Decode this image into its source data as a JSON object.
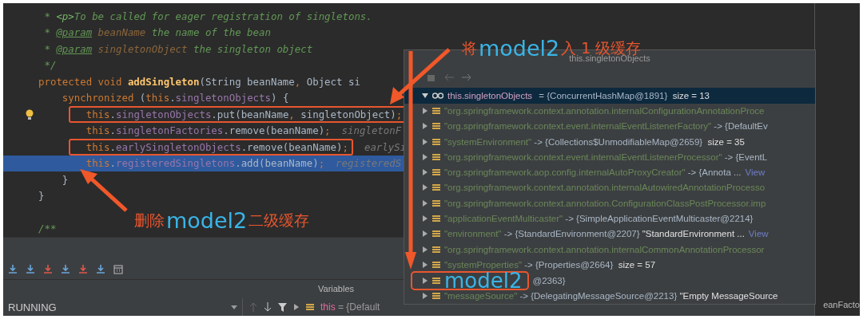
{
  "editor": {
    "lines": [
      {
        "tokens": [
          {
            "kind": "comment",
            "text": " * "
          },
          {
            "kind": "tag",
            "text": "<p>"
          },
          {
            "kind": "comment",
            "text": "To be called for eager registration of singletons."
          }
        ],
        "current": false,
        "boxed": false
      },
      {
        "tokens": [
          {
            "kind": "comment",
            "text": " * "
          },
          {
            "kind": "doctag",
            "text": "@param"
          },
          {
            "kind": "param",
            "text": " beanName"
          },
          {
            "kind": "comment",
            "text": " the name of the bean"
          }
        ],
        "current": false,
        "boxed": false
      },
      {
        "tokens": [
          {
            "kind": "comment",
            "text": " * "
          },
          {
            "kind": "doctag",
            "text": "@param"
          },
          {
            "kind": "param",
            "text": " singletonObject"
          },
          {
            "kind": "comment",
            "text": " the singleton object"
          }
        ],
        "current": false,
        "boxed": false
      },
      {
        "tokens": [
          {
            "kind": "comment",
            "text": " */"
          }
        ],
        "current": false,
        "boxed": false
      },
      {
        "tokens": [
          {
            "kind": "keyword",
            "text": "protected void "
          },
          {
            "kind": "method",
            "text": "addSingleton"
          },
          {
            "kind": "plain",
            "text": "(String beanName"
          },
          {
            "kind": "keyword",
            "text": ", "
          },
          {
            "kind": "plain",
            "text": "Object si"
          }
        ],
        "current": false,
        "boxed": false
      },
      {
        "tokens": [
          {
            "kind": "keyword",
            "text": "    synchronized "
          },
          {
            "kind": "plain",
            "text": "("
          },
          {
            "kind": "keyword",
            "text": "this"
          },
          {
            "kind": "plain",
            "text": "."
          },
          {
            "kind": "field",
            "text": "singletonObjects"
          },
          {
            "kind": "plain",
            "text": ") {"
          }
        ],
        "current": false,
        "boxed": false
      },
      {
        "tokens": [
          {
            "kind": "keyword",
            "text": "        this"
          },
          {
            "kind": "plain",
            "text": "."
          },
          {
            "kind": "field",
            "text": "singletonObjects"
          },
          {
            "kind": "plain",
            "text": ".put(beanName"
          },
          {
            "kind": "keyword",
            "text": ", "
          },
          {
            "kind": "plain",
            "text": "singletonObject)"
          },
          {
            "kind": "keyword",
            "text": ";"
          }
        ],
        "current": false,
        "boxed": true
      },
      {
        "tokens": [
          {
            "kind": "keyword",
            "text": "        this"
          },
          {
            "kind": "plain",
            "text": "."
          },
          {
            "kind": "field",
            "text": "singletonFactories"
          },
          {
            "kind": "plain",
            "text": ".remove(beanName)"
          },
          {
            "kind": "keyword",
            "text": ";"
          },
          {
            "kind": "hint",
            "text": "singletonF"
          }
        ],
        "current": false,
        "boxed": false
      },
      {
        "tokens": [
          {
            "kind": "keyword",
            "text": "        this"
          },
          {
            "kind": "plain",
            "text": "."
          },
          {
            "kind": "field",
            "text": "earlySingletonObjects"
          },
          {
            "kind": "plain",
            "text": ".remove(beanName)"
          },
          {
            "kind": "keyword",
            "text": ";"
          },
          {
            "kind": "hint",
            "text": "earlySi"
          }
        ],
        "current": false,
        "boxed": true
      },
      {
        "tokens": [
          {
            "kind": "keyword",
            "text": "        this"
          },
          {
            "kind": "plain",
            "text": "."
          },
          {
            "kind": "field",
            "text": "registeredSingletons"
          },
          {
            "kind": "plain",
            "text": ".add(beanName)"
          },
          {
            "kind": "keyword",
            "text": ";"
          },
          {
            "kind": "hint",
            "text": "registeredS"
          }
        ],
        "current": true,
        "boxed": false
      },
      {
        "tokens": [
          {
            "kind": "plain",
            "text": "    }"
          }
        ],
        "current": false,
        "boxed": false
      },
      {
        "tokens": [
          {
            "kind": "plain",
            "text": "}"
          }
        ],
        "current": false,
        "boxed": false
      },
      {
        "current": false,
        "boxed": false
      },
      {
        "tokens": [
          {
            "kind": "comment",
            "text": "/**"
          }
        ],
        "current": false,
        "boxed": false
      }
    ]
  },
  "popup": {
    "title": "this.singletonObjects",
    "root": {
      "name": "this.singletonObjects",
      "value": " = {ConcurrentHashMap@1891}",
      "note": "  size = 13",
      "expanded": true,
      "selected": true
    },
    "rows": [
      {
        "key": "\"org.springframework.context.annotation.internalConfigurationAnnotationProce"
      },
      {
        "key": "\"org.springframework.context.event.internalEventListenerFactory\"",
        "value": " -> {DefaultEv"
      },
      {
        "key": "\"systemEnvironment\"",
        "value": " -> {Collections$UnmodifiableMap@2659}",
        "note": "  size = 35"
      },
      {
        "key": "\"org.springframework.context.event.internalEventListenerProcessor\"",
        "value": " -> {EventL"
      },
      {
        "key": "\"org.springframework.aop.config.internalAutoProxyCreator\"",
        "value": " -> {Annota ...",
        "link": "View"
      },
      {
        "key": "\"org.springframework.context.annotation.internalAutowiredAnnotationProcesso"
      },
      {
        "key": "\"org.springframework.context.annotation.ConfigurationClassPostProcessor.imp"
      },
      {
        "key": "\"applicationEventMulticaster\"",
        "value": " -> {SimpleApplicationEventMulticaster@2214}"
      },
      {
        "key": "\"environment\"",
        "value": " -> {StandardEnvironment@2207}",
        "note": " \"StandardEnvironment ...",
        "link": "View"
      },
      {
        "key": "\"org.springframework.context.annotation.internalCommonAnnotationProcessor"
      },
      {
        "key": "\"systemProperties\"",
        "value": " -> {Properties@2664}",
        "note": "  size = 57"
      },
      {
        "overlay": "model2",
        "value": "@2363}"
      },
      {
        "key": "\"messageSource\"",
        "value": " -> {DelegatingMessageSource@2213}",
        "note": " \"Empty MessageSource"
      }
    ]
  },
  "debugger": {
    "variables_title": "Variables",
    "thread": "RUNNING",
    "variable": {
      "name": "this",
      "value": " = {Default"
    }
  },
  "side_text": "eanFacto",
  "callouts": [
    {
      "before": "将",
      "after": "入 1 级缓存",
      "overlay": "model2"
    },
    {
      "before": "删除",
      "after": "二级缓存",
      "overlay": "model2"
    }
  ]
}
